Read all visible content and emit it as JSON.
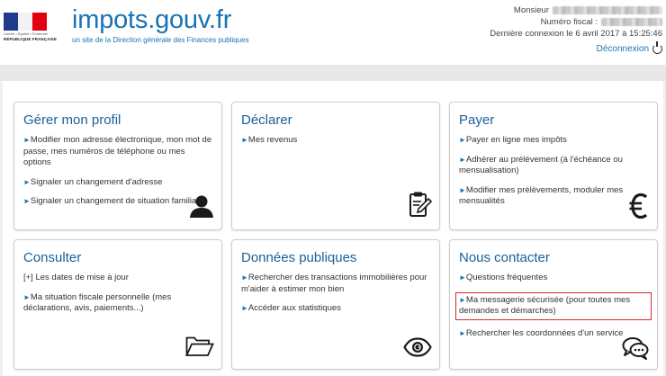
{
  "header": {
    "logo_text": "impots.gouv.fr",
    "logo_subtitle": "un site de la Direction générale des Finances publiques",
    "marianne_motto": "Liberté • Égalité • Fraternité",
    "marianne_republic": "RÉPUBLIQUE FRANÇAISE",
    "user_prefix": "Monsieur",
    "fiscal_label": "Numéro fiscal :",
    "last_login": "Dernière connexion le 6 avril 2017 à 15:25:46",
    "logout_label": "Déconnexion"
  },
  "cards": {
    "profil": {
      "title": "Gérer mon profil",
      "links": [
        "Modifier mon adresse électronique, mon mot de passe, mes numéros de téléphone ou mes options",
        "Signaler un changement d'adresse",
        "Signaler un changement de situation familiale"
      ]
    },
    "declarer": {
      "title": "Déclarer",
      "links": [
        "Mes revenus"
      ]
    },
    "payer": {
      "title": "Payer",
      "links": [
        "Payer en ligne mes impôts",
        "Adhérer au prélèvement (à l'échéance ou mensualisation)",
        "Modifier mes prélèvements, moduler mes mensualités"
      ]
    },
    "consulter": {
      "title": "Consulter",
      "plus_label": "[+]",
      "links": [
        "Les dates de mise à jour",
        "Ma situation fiscale personnelle (mes déclarations, avis, paiements...)"
      ]
    },
    "donnees": {
      "title": "Données publiques",
      "links": [
        "Rechercher des transactions immobilières pour m'aider à estimer mon bien",
        "Accéder aux statistiques"
      ]
    },
    "contact": {
      "title": "Nous contacter",
      "links": [
        "Questions fréquentes",
        "Ma messagerie sécurisée (pour toutes mes demandes et démarches)",
        "Rechercher les coordonnées d'un service"
      ]
    }
  },
  "icons": {
    "profil": "user-icon",
    "declarer": "clipboard-pen-icon",
    "payer": "euro-icon",
    "consulter": "folder-open-icon",
    "donnees": "eye-icon",
    "contact": "chat-bubbles-icon"
  },
  "colors": {
    "brand_blue": "#1a73b3",
    "title_blue": "#1a5f96",
    "highlight_red": "#d9262a"
  }
}
